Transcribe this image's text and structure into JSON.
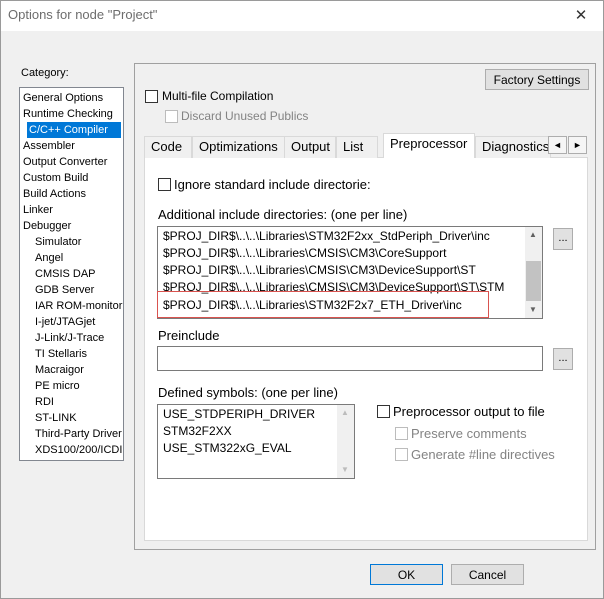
{
  "window": {
    "title": "Options for node \"Project\"",
    "close_symbol": "✕"
  },
  "category": {
    "label": "Category:",
    "items": [
      "General Options",
      "Runtime Checking",
      "C/C++ Compiler",
      "Assembler",
      "Output Converter",
      "Custom Build",
      "Build Actions",
      "Linker",
      "Debugger",
      "Simulator",
      "Angel",
      "CMSIS DAP",
      "GDB Server",
      "IAR ROM-monitor",
      "I-jet/JTAGjet",
      "J-Link/J-Trace",
      "TI Stellaris",
      "Macraigor",
      "PE micro",
      "RDI",
      "ST-LINK",
      "Third-Party Driver",
      "XDS100/200/ICDI"
    ],
    "selected_index": 2
  },
  "panel": {
    "factory_settings": "Factory Settings",
    "multi_file": {
      "label": "Multi-file Compilation",
      "checked": false
    },
    "discard_unused": {
      "label": "Discard Unused Publics",
      "checked": false,
      "enabled": false
    }
  },
  "tabs": {
    "items": [
      "Code",
      "Optimizations",
      "Output",
      "List",
      "Preprocessor",
      "Diagnostics"
    ],
    "active": "Preprocessor",
    "scroll_left": "◄",
    "scroll_right": "►"
  },
  "preprocessor": {
    "ignore_std": {
      "label": "Ignore standard include directorie:",
      "checked": false
    },
    "include_dirs_label": "Additional include directories: (one per line)",
    "include_dirs": [
      "$PROJ_DIR$\\..\\..\\Libraries\\STM32F2xx_StdPeriph_Driver\\inc",
      "$PROJ_DIR$\\..\\..\\Libraries\\CMSIS\\CM3\\CoreSupport",
      "$PROJ_DIR$\\..\\..\\Libraries\\CMSIS\\CM3\\DeviceSupport\\ST",
      "$PROJ_DIR$\\..\\..\\Libraries\\CMSIS\\CM3\\DeviceSupport\\ST\\STM",
      "$PROJ_DIR$\\..\\..\\Libraries\\STM32F2x7_ETH_Driver\\inc"
    ],
    "browse_label": "...",
    "preinclude_label": "Preinclude",
    "preinclude_value": "",
    "defined_label": "Defined symbols: (one per line)",
    "defined_symbols": [
      "USE_STDPERIPH_DRIVER",
      "STM32F2XX",
      "USE_STM322xG_EVAL"
    ],
    "pp_output": {
      "label": "Preprocessor output to file",
      "checked": false
    },
    "preserve_comments": {
      "label": "Preserve comments",
      "checked": false,
      "enabled": false
    },
    "generate_line": {
      "label": "Generate #line directives",
      "checked": false,
      "enabled": false
    }
  },
  "footer": {
    "ok": "OK",
    "cancel": "Cancel"
  },
  "colors": {
    "selection": "#0078d7",
    "highlight_box": "#d9534f"
  }
}
